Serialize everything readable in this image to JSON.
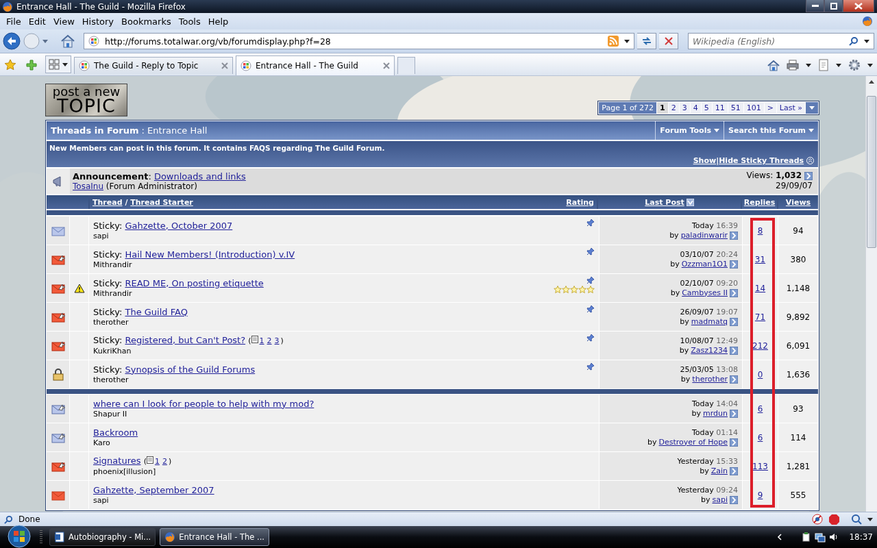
{
  "window": {
    "title": "Entrance Hall - The Guild - Mozilla Firefox"
  },
  "menu": [
    "File",
    "Edit",
    "View",
    "History",
    "Bookmarks",
    "Tools",
    "Help"
  ],
  "address": {
    "value": "http://forums.totalwar.org/vb/forumdisplay.php?f=28"
  },
  "search": {
    "placeholder": "Wikipedia (English)"
  },
  "tabs": [
    {
      "label": "The Guild - Reply to Topic",
      "selected": false
    },
    {
      "label": "Entrance Hall - The Guild",
      "selected": true
    }
  ],
  "forum": {
    "post_button": {
      "line_1": "post a new",
      "line_2": "TOPIC"
    },
    "pagination": {
      "label": "Page 1 of 272",
      "pages": [
        {
          "label": "1",
          "selected": true
        },
        {
          "label": "2",
          "selected": false
        },
        {
          "label": "3",
          "selected": false
        },
        {
          "label": "4",
          "selected": false
        },
        {
          "label": "5",
          "selected": false
        },
        {
          "label": "11",
          "selected": false
        },
        {
          "label": "51",
          "selected": false
        },
        {
          "label": "101",
          "selected": false
        }
      ],
      "next": ">",
      "last": "Last »"
    },
    "header": {
      "title": "Threads in Forum",
      "separator": ":",
      "name": "Entrance Hall",
      "tools": [
        "Forum Tools",
        "Search this Forum"
      ]
    },
    "description": "New Members can post in this forum. It contains FAQS regarding The Guild Forum.",
    "sticky_toggle": {
      "show": "Show",
      "divider": "|",
      "hide": "Hide Sticky Threads"
    },
    "announcement": {
      "label": "**Announcement**:",
      "title": "Downloads and links",
      "author": "TosaInu",
      "role": "(Forum Administrator)",
      "views": "Views: **1,032**",
      "date": "29/09/07"
    },
    "columns": {
      "thread": "Thread",
      "divider": "/",
      "starter": "Thread Starter",
      "rating": "Rating",
      "last_post": "Last Post",
      "replies": {
        "label": "Replies",
        "highlighted": true
      },
      "views": "Views"
    },
    "sticky_threads": [
      {
        "kind": "read",
        "sticky_label": "Sticky:",
        "title": "Gahzette, October 2007",
        "starter": "sapi",
        "pinned": true,
        "date": "Today",
        "time": "16:39",
        "by": "by",
        "last_poster": "paladinwarir",
        "replies": "8",
        "views": "94"
      },
      {
        "kind": "hot_posted",
        "sticky_label": "Sticky:",
        "title": "Hail New Members! (Introduction) v.IV",
        "starter": "Mithrandir",
        "pinned": true,
        "date": "03/10/07",
        "time": "20:24",
        "by": "by",
        "last_poster": "Ozzman1O1",
        "replies": "31",
        "views": "380"
      },
      {
        "kind": "hot_posted",
        "warning": true,
        "sticky_label": "Sticky:",
        "title": "READ ME, On posting etiquette",
        "starter": "Mithrandir",
        "pinned": true,
        "stars": 5,
        "date": "02/10/07",
        "time": "09:20",
        "by": "by",
        "last_poster": "Cambyses II",
        "replies": "14",
        "views": "1,148"
      },
      {
        "kind": "hot_posted",
        "sticky_label": "Sticky:",
        "title": "The Guild FAQ",
        "starter": "therother",
        "pinned": true,
        "date": "26/09/07",
        "time": "19:07",
        "by": "by",
        "last_poster": "madmatq",
        "replies": "71",
        "views": "9,892"
      },
      {
        "kind": "hot_posted",
        "sticky_label": "Sticky:",
        "title": "Registered, but Can't Post?",
        "pages": {
          "open": "(",
          "links": [
            "1",
            "2",
            "3"
          ],
          "close": ")"
        },
        "starter": "KukriKhan",
        "pinned": true,
        "date": "10/08/07",
        "time": "12:49",
        "by": "by",
        "last_poster": "Zasz1234",
        "replies": "212",
        "views": "6,091"
      },
      {
        "kind": "locked",
        "sticky_label": "Sticky:",
        "title": "Synopsis of the Guild Forums",
        "starter": "therother",
        "pinned": true,
        "date": "25/03/05",
        "time": "13:08",
        "by": "by",
        "last_poster": "therother",
        "replies": "0",
        "views": "1,636"
      }
    ],
    "threads": [
      {
        "kind": "posted",
        "title": "where can I look for people to help with my mod?",
        "starter": "Shapur II",
        "date": "Today",
        "time": "14:04",
        "by": "by",
        "last_poster": "mrdun",
        "replies": "6",
        "views": "93"
      },
      {
        "kind": "posted",
        "title": "Backroom",
        "starter": "Karo",
        "date": "Today",
        "time": "01:14",
        "by": "by",
        "last_poster": "Destroyer of Hope",
        "replies": "6",
        "views": "114"
      },
      {
        "kind": "hot_posted",
        "title": "Signatures",
        "pages": {
          "open": "(",
          "links": [
            "1",
            "2"
          ],
          "close": ")"
        },
        "starter": "phoenix[illusion]",
        "date": "Yesterday",
        "time": "15:33",
        "by": "by",
        "last_poster": "Zain",
        "replies": "113",
        "views": "1,281"
      },
      {
        "kind": "hot",
        "title": "Gahzette, September 2007",
        "starter": "sapi",
        "date": "Yesterday",
        "time": "09:24",
        "by": "by",
        "last_poster": "sapi",
        "replies": "9",
        "views": "555"
      }
    ]
  },
  "status_bar": {
    "text": "Done"
  },
  "taskbar": {
    "buttons": [
      {
        "label": "Autobiography - Mi...",
        "kind": "document",
        "selected": false
      },
      {
        "label": "Entrance Hall - The ...",
        "kind": "browser",
        "selected": true
      }
    ],
    "clock": "18:37"
  }
}
